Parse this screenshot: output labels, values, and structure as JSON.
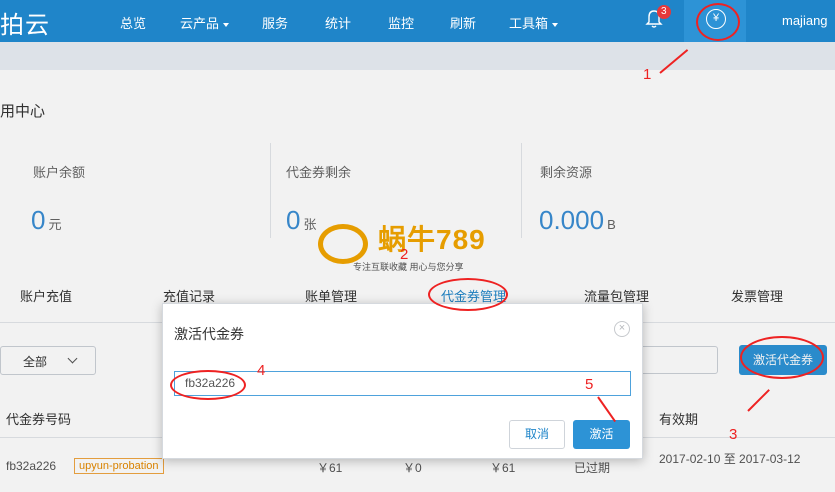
{
  "nav": {
    "logo": "拍云",
    "items": [
      "总览",
      "云产品",
      "服务",
      "统计",
      "监控",
      "刷新",
      "工具箱"
    ],
    "notification_count": "3",
    "yen_icon": "¥",
    "user": "majiang"
  },
  "page": {
    "title": "用中心"
  },
  "stats": [
    {
      "label": "账户余额",
      "value": "0",
      "unit": "元"
    },
    {
      "label": "代金券剩余",
      "value": "0",
      "unit": "张"
    },
    {
      "label": "剩余资源",
      "value": "0.000",
      "unit": "B"
    }
  ],
  "tabs": [
    "账户充值",
    "充值记录",
    "账单管理",
    "代金券管理",
    "流量包管理",
    "发票管理"
  ],
  "filter": {
    "selected": "全部"
  },
  "actions": {
    "activate_voucher": "激活代金券"
  },
  "table": {
    "headers": [
      "代金券号码",
      "有效期"
    ],
    "row": {
      "code": "fb32a226",
      "tag": "upyun-probation",
      "col3": "￥61",
      "col4": "￥0",
      "col5": "￥61",
      "status": "已过期",
      "validity": "2017-02-10 至 2017-03-12"
    }
  },
  "modal": {
    "title": "激活代金券",
    "close": "×",
    "input_value": "fb32a226",
    "cancel": "取消",
    "confirm": "激活"
  },
  "watermark": {
    "main": "蜗牛789",
    "sub": "专注互联收藏  用心与您分享"
  },
  "annotations": [
    "1",
    "2",
    "3",
    "4",
    "5"
  ],
  "colors": {
    "brand": "#1f85c9",
    "accent": "#2d93d6",
    "annotation": "#e22222",
    "tag": "#e58a00"
  }
}
